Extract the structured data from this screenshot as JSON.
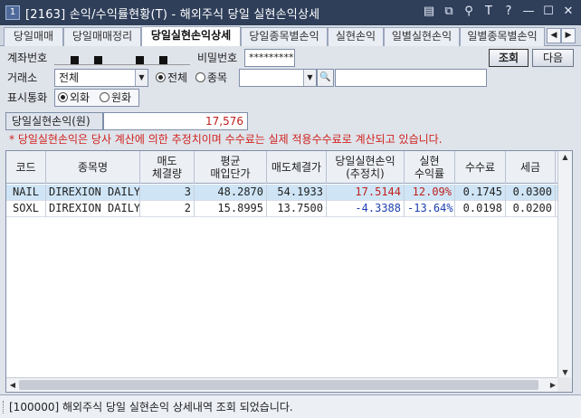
{
  "window": {
    "icon_label": "1",
    "title": "[2163] 손익/수익률현황(T) - 해외주식 당일 실현손익상세",
    "controls": [
      "grid-icon",
      "window-icon",
      "pin-icon",
      "font-size-icon",
      "help-icon",
      "minimize-icon",
      "maximize-icon",
      "close-icon"
    ],
    "control_glyphs": [
      "▤",
      "⧉",
      "⚲",
      "T",
      "?",
      "—",
      "☐",
      "✕"
    ]
  },
  "tabs": [
    {
      "label": "당일매매"
    },
    {
      "label": "당일매매정리"
    },
    {
      "label": "당일실현손익상세",
      "active": true
    },
    {
      "label": "당일종목별손익"
    },
    {
      "label": "실현손익"
    },
    {
      "label": "일별실현손익"
    },
    {
      "label": "일별종목별손익"
    }
  ],
  "tab_scroll": {
    "prev": "◀",
    "next": "▶"
  },
  "form": {
    "account_label": "계좌번호",
    "password_label": "비밀번호",
    "password_value": "*********",
    "query_button": "조회",
    "next_button": "다음",
    "exchange_label": "거래소",
    "exchange_value": "전체",
    "radio_all": "전체",
    "radio_symbol": "종목",
    "symbol_value": "",
    "symbol_name_value": "",
    "currency_label": "표시통화",
    "radio_foreign": "외화",
    "radio_krw": "원화",
    "dropdown_arrow": "▼",
    "search_glyph": "🔍"
  },
  "summary": {
    "label": "당일실현손익(원)",
    "value": "17,576"
  },
  "notice": "* 당일실현손익은 당사 계산에 의한 추정치이며 수수료는 실제 적용수수료로 계산되고 있습니다.",
  "table": {
    "headers": [
      "코드",
      "종목명",
      "매도\n체결량",
      "평균\n매입단가",
      "매도체결가",
      "당일실현손익\n(추정치)",
      "실현\n수익률",
      "수수료",
      "세금"
    ],
    "rows": [
      {
        "code": "NAIL",
        "name": "DIREXION DAILY H",
        "qty": "3",
        "avg_price": "48.2870",
        "sell_price": "54.1933",
        "pnl": "17.5144",
        "rate": "12.09%",
        "fee": "0.1745",
        "tax": "0.0300",
        "sign": "pos"
      },
      {
        "code": "SOXL",
        "name": "DIREXION DAILY S",
        "qty": "2",
        "avg_price": "15.8995",
        "sell_price": "13.7500",
        "pnl": "-4.3388",
        "rate": "-13.64%",
        "fee": "0.0198",
        "tax": "0.0200",
        "sign": "neg"
      }
    ],
    "scroll_up": "▲",
    "scroll_down": "▼",
    "scroll_left": "◀",
    "scroll_right": "▶"
  },
  "colors": {
    "positive": "#c0201c",
    "negative": "#1c3fb0",
    "selected_row": "#cfe5f6"
  },
  "status": "[100000] 해외주식 당일 실현손익 상세내역 조회 되었습니다."
}
